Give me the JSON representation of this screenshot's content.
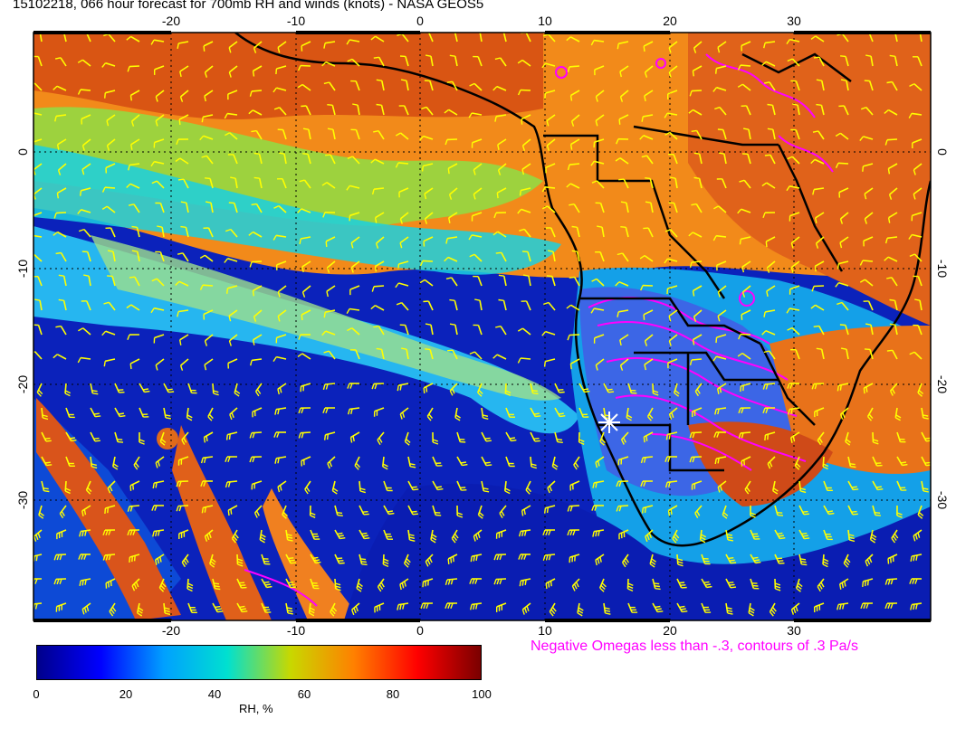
{
  "title": "15102218, 066 hour forecast for 700mb RH and winds (knots) - NASA GEOS5",
  "map": {
    "lon_ticks": [
      "-20",
      "-10",
      "0",
      "10",
      "20",
      "30"
    ],
    "lat_ticks": [
      "0",
      "-10",
      "-20",
      "-30"
    ],
    "lon_range": [
      -30,
      40
    ],
    "lat_range": [
      -40,
      10
    ],
    "star_marker": {
      "lon": 15,
      "lat": -24,
      "color": "#ffffff"
    },
    "barb_color": "#ffff00",
    "coast_color": "#000000",
    "omega_color": "#ff00ff",
    "grid_style": "dotted"
  },
  "omega_note": "Negative Omegas less than -.3, contours of .3 Pa/s",
  "colorbar": {
    "ticks": [
      "0",
      "20",
      "40",
      "60",
      "80",
      "100"
    ],
    "label": "RH, %",
    "colors": [
      "#00008b",
      "#0000ff",
      "#00a0ff",
      "#00e0d0",
      "#c8d800",
      "#ff8000",
      "#ff0000",
      "#7a0000"
    ]
  }
}
